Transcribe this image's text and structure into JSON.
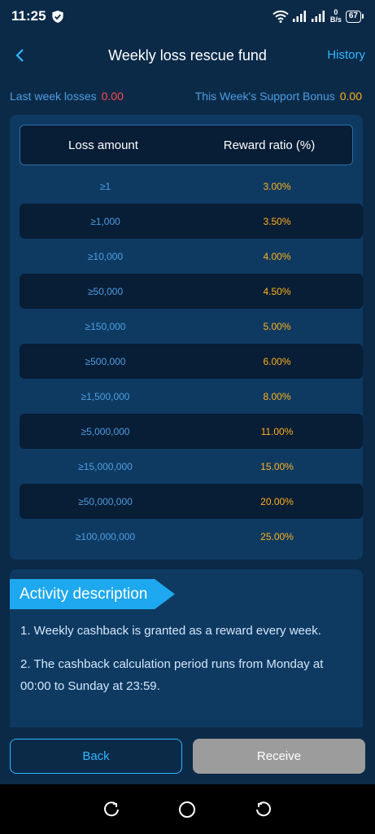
{
  "status_bar": {
    "time": "11:25",
    "net_speed_value": "0",
    "net_speed_unit": "B/s",
    "battery": "67"
  },
  "header": {
    "title": "Weekly loss rescue fund",
    "history_label": "History"
  },
  "summary": {
    "last_week_losses_label": "Last week losses",
    "last_week_losses_value": "0.00",
    "support_bonus_label": "This Week's Support Bonus",
    "support_bonus_value": "0.00"
  },
  "table": {
    "headers": [
      "Loss amount",
      "Reward ratio (%)"
    ],
    "rows": [
      {
        "amount": "≥1",
        "ratio": "3.00%"
      },
      {
        "amount": "≥1,000",
        "ratio": "3.50%"
      },
      {
        "amount": "≥10,000",
        "ratio": "4.00%"
      },
      {
        "amount": "≥50,000",
        "ratio": "4.50%"
      },
      {
        "amount": "≥150,000",
        "ratio": "5.00%"
      },
      {
        "amount": "≥500,000",
        "ratio": "6.00%"
      },
      {
        "amount": "≥1,500,000",
        "ratio": "8.00%"
      },
      {
        "amount": "≥5,000,000",
        "ratio": "11.00%"
      },
      {
        "amount": "≥15,000,000",
        "ratio": "15.00%"
      },
      {
        "amount": "≥50,000,000",
        "ratio": "20.00%"
      },
      {
        "amount": "≥100,000,000",
        "ratio": "25.00%"
      }
    ]
  },
  "activity": {
    "title": "Activity description",
    "items": [
      "1. Weekly cashback is granted as a reward every week.",
      "2. The cashback calculation period runs from Monday at 00:00 to Sunday at 23:59."
    ]
  },
  "buttons": {
    "back_label": "Back",
    "receive_label": "Receive"
  },
  "colors": {
    "background": "#0b2a48",
    "panel": "#0e3a62",
    "accent": "#2fb6ff",
    "orange": "#ffb21a",
    "red": "#ff4a4a",
    "disabled": "#9c9c9c"
  },
  "icons": {
    "status": [
      "shield-icon",
      "wifi-icon",
      "signal-icon",
      "battery-icon"
    ],
    "header": "back-arrow-icon",
    "nav": [
      "recents-icon",
      "home-icon",
      "back-icon"
    ]
  }
}
